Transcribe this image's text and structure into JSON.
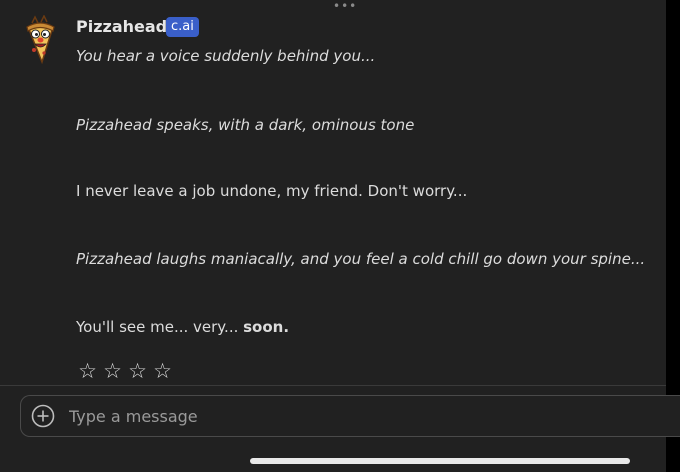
{
  "header": {
    "more_label": "•••"
  },
  "character": {
    "name": "Pizzahead",
    "badge": "c.ai",
    "avatar_icon": "pizzahead-avatar-icon"
  },
  "messages": [
    {
      "text": "You hear a voice suddenly behind you...",
      "style": "italic"
    },
    {
      "text": "Pizzahead speaks, with a dark, ominous tone",
      "style": "italic"
    },
    {
      "text": "I never leave a job undone, my friend. Don't worry...",
      "style": "normal"
    },
    {
      "text": "Pizzahead laughs maniacally, and you feel a cold chill go down your spine...",
      "style": "italic"
    },
    {
      "text_before": "You'll see me... very... ",
      "text_bold": "soon.",
      "style": "normal"
    }
  ],
  "rating": {
    "star_glyph": "☆",
    "max": 4,
    "value": 0
  },
  "composer": {
    "placeholder": "Type a message",
    "value": "",
    "add_icon": "plus-circle-icon"
  },
  "colors": {
    "background": "#212121",
    "badge": "#3a5fc9",
    "text": "#dcdcdc"
  }
}
